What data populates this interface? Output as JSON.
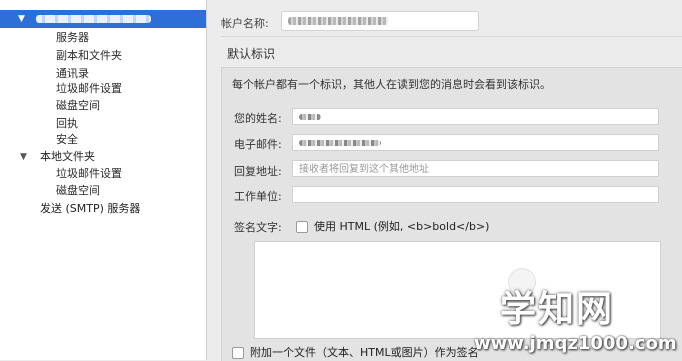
{
  "sidebar": {
    "account_expanded_icon": "triangle-down-icon",
    "account_children": [
      "服务器",
      "副本和文件夹",
      "通讯录",
      "垃圾邮件设置",
      "磁盘空间",
      "回执",
      "安全"
    ],
    "local_folders": {
      "label": "本地文件夹",
      "children": [
        "垃圾邮件设置",
        "磁盘空间"
      ]
    },
    "smtp": "发送 (SMTP) 服务器"
  },
  "main": {
    "account_name_label": "帐户名称:",
    "section_title": "默认标识",
    "description": "每个帐户都有一个标识，其他人在读到您的消息时会看到该标识。",
    "fields": {
      "name_label": "您的姓名:",
      "email_label": "电子邮件:",
      "reply_label": "回复地址:",
      "reply_placeholder": "接收者将回复到这个其他地址",
      "org_label": "工作单位:"
    },
    "signature_label": "签名文字:",
    "use_html_label": "使用 HTML (例如, <b>bold</b>)",
    "attach_label": "附加一个文件（文本、HTML或图片）作为签名"
  },
  "watermark": {
    "logo": "学知网",
    "url": "www.jmqz1000.com"
  },
  "colors": {
    "selection": "#2d6fd6",
    "window_bg": "#ececec",
    "panel_bg": "#e3e3e3"
  }
}
